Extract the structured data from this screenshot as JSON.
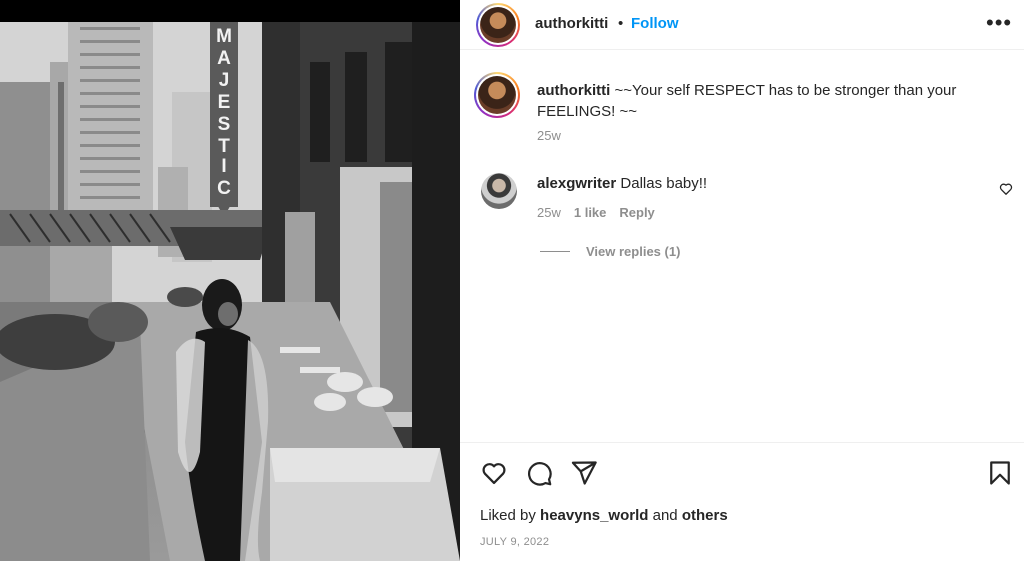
{
  "post": {
    "photo": {
      "alt_icon": "photo-image",
      "sign_text": "MAJESTIC"
    },
    "header": {
      "username": "authorkitti",
      "dot": "•",
      "follow_label": "Follow",
      "more_icon": "more-horizontal-icon",
      "more_label": "•••"
    },
    "caption": {
      "username": "authorkitti",
      "text": "~~Your self RESPECT has to be stronger than your FEELINGS! ~~",
      "time": "25w"
    },
    "comments": [
      {
        "username": "alexgwriter",
        "text": "Dallas baby!!",
        "time": "25w",
        "likes": "1 like",
        "reply_label": "Reply",
        "view_replies": "View replies (1)"
      }
    ],
    "actions": {
      "like_icon": "heart-icon",
      "comment_icon": "comment-icon",
      "share_icon": "send-icon",
      "save_icon": "bookmark-icon"
    },
    "liked_by": {
      "prefix": "Liked by",
      "user": "heavyns_world",
      "and": "and",
      "others": "others"
    },
    "date": "JULY 9, 2022"
  },
  "colors": {
    "accent": "#0095f6",
    "text": "#262626",
    "muted": "#8e8e8e",
    "border": "#efefef"
  }
}
